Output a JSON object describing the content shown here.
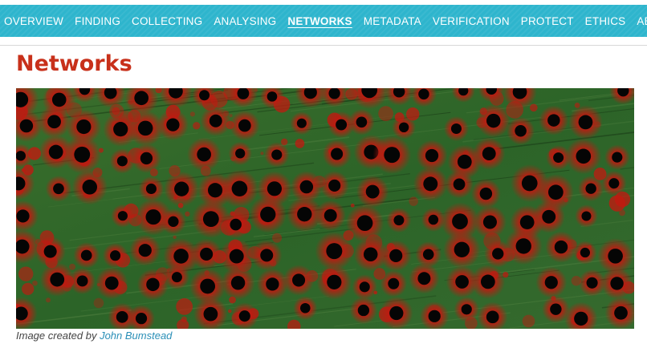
{
  "nav": {
    "items": [
      {
        "label": "OVERVIEW",
        "active": false
      },
      {
        "label": "FINDING",
        "active": false
      },
      {
        "label": "COLLECTING",
        "active": false
      },
      {
        "label": "ANALYSING",
        "active": false
      },
      {
        "label": "NETWORKS",
        "active": true
      },
      {
        "label": "METADATA",
        "active": false
      },
      {
        "label": "VERIFICATION",
        "active": false
      },
      {
        "label": "PROTECT",
        "active": false
      },
      {
        "label": "ETHICS",
        "active": false
      },
      {
        "label": "ABOUT",
        "active": false
      }
    ]
  },
  "page": {
    "title": "Networks"
  },
  "hero": {
    "caption_prefix": "Image created by",
    "caption_author": "John Bumstead"
  },
  "colors": {
    "nav_bg": "#2eb5cd",
    "title": "#c8301a",
    "link": "#2a8fb7",
    "board_green": "#2f6b2a",
    "board_red": "#c21810"
  }
}
